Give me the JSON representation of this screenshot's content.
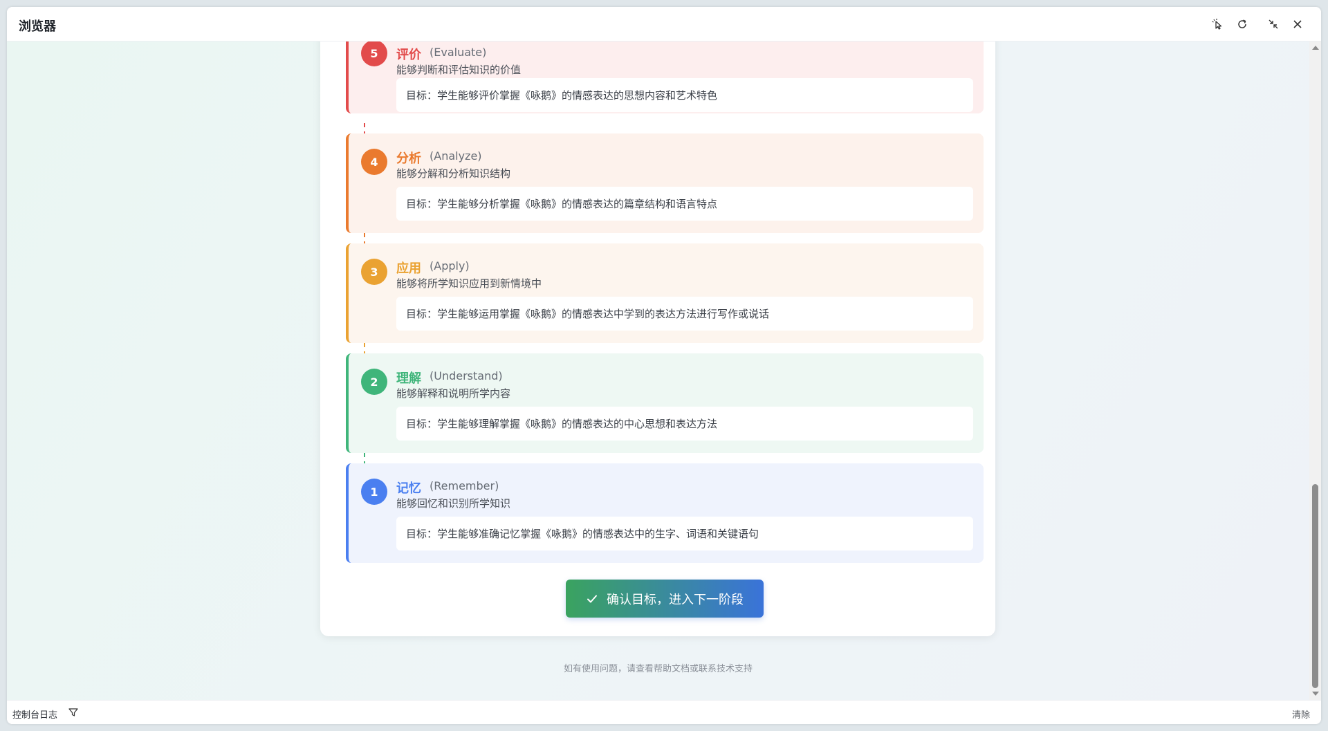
{
  "window": {
    "title": "浏览器"
  },
  "icons": {
    "pointer": "cursor-click-icon",
    "refresh": "refresh-icon",
    "collapse": "collapse-icon",
    "close": "close-icon",
    "filter": "filter-icon",
    "check": "check-icon"
  },
  "levels": [
    {
      "number": "5",
      "name": "评价",
      "en": "(Evaluate)",
      "desc": "能够判断和评估知识的价值",
      "goal": "目标：学生能够评价掌握《咏鹅》的情感表达的思想内容和艺术特色",
      "color": "#e24b4b",
      "bg": "#fdeeee"
    },
    {
      "number": "4",
      "name": "分析",
      "en": "(Analyze)",
      "desc": "能够分解和分析知识结构",
      "goal": "目标：学生能够分析掌握《咏鹅》的情感表达的篇章结构和语言特点",
      "color": "#ea7a2e",
      "bg": "#fdf2ec"
    },
    {
      "number": "3",
      "name": "应用",
      "en": "(Apply)",
      "desc": "能够将所学知识应用到新情境中",
      "goal": "目标：学生能够运用掌握《咏鹅》的情感表达中学到的表达方法进行写作或说话",
      "color": "#eaa232",
      "bg": "#fdf5ee"
    },
    {
      "number": "2",
      "name": "理解",
      "en": "(Understand)",
      "desc": "能够解释和说明所学内容",
      "goal": "目标：学生能够理解掌握《咏鹅》的情感表达的中心思想和表达方法",
      "color": "#3fb57a",
      "bg": "#eef8f3"
    },
    {
      "number": "1",
      "name": "记忆",
      "en": "(Remember)",
      "desc": "能够回忆和识别所学知识",
      "goal": "目标：学生能够准确记忆掌握《咏鹅》的情感表达中的生字、词语和关键语句",
      "color": "#4a7ff0",
      "bg": "#eff3fd"
    }
  ],
  "confirm_label": "确认目标，进入下一阶段",
  "footer_note": "如有使用问题，请查看帮助文档或联系技术支持",
  "statusbar": {
    "console_label": "控制台日志",
    "clear_label": "清除"
  }
}
